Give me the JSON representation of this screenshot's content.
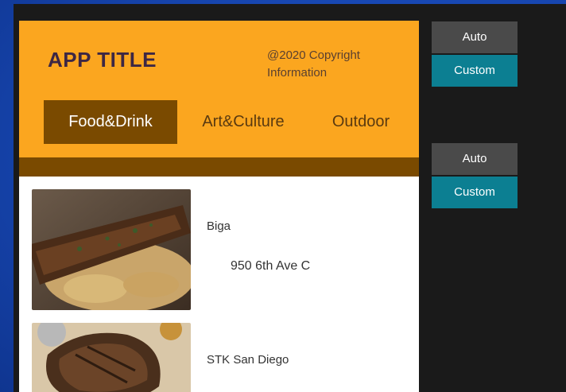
{
  "app": {
    "title": "APP TITLE",
    "copyright": "@2020 Copyright Information",
    "tabs": [
      {
        "label": "Food&Drink",
        "active": true
      },
      {
        "label": "Art&Culture",
        "active": false
      },
      {
        "label": "Outdoor",
        "active": false
      }
    ],
    "accent": "#fba61f",
    "accent_dark": "#7a4a00"
  },
  "listings": [
    {
      "name": "Biga",
      "address": "950 6th Ave C"
    },
    {
      "name": "STK San Diego",
      "address": ""
    }
  ],
  "layout_options": [
    {
      "auto_label": "Auto",
      "custom_label": "Custom"
    },
    {
      "auto_label": "Auto",
      "custom_label": "Custom"
    }
  ]
}
